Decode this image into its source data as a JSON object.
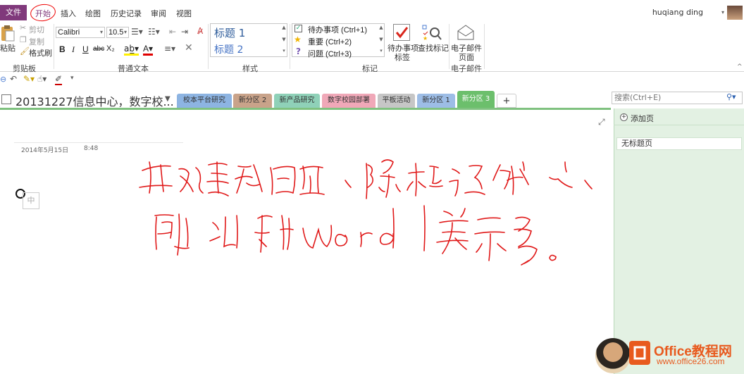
{
  "menubar": {
    "file_label": "文件",
    "tabs": [
      "开始",
      "插入",
      "绘图",
      "历史记录",
      "审阅",
      "视图"
    ],
    "active_tab": "开始",
    "user_name": "huqiang ding"
  },
  "clipboard": {
    "paste": "粘贴",
    "cut": "剪切",
    "copy": "复制",
    "format_painter": "格式刷",
    "group_label": "剪贴板"
  },
  "basic_text": {
    "font_name": "Calibri",
    "font_size": "10.5",
    "bold": "B",
    "italic": "I",
    "underline": "U",
    "strike": "abc",
    "subscript": "X₂",
    "group_label": "普通文本"
  },
  "styles": {
    "heading1": "标题 1",
    "heading2": "标题 2",
    "group_label": "样式"
  },
  "tags": {
    "items": [
      "待办事项 (Ctrl+1)",
      "重要 (Ctrl+2)",
      "问题 (Ctrl+3)"
    ],
    "todo_tag_line1": "待办事项",
    "todo_tag_line2": "标签",
    "find_tags": "查找标记",
    "group_label": "标记"
  },
  "email": {
    "label_line1": "电子邮件",
    "label_line2": "页面",
    "group_label": "电子邮件"
  },
  "notebook": {
    "title": "20131227信息中心，数字校...",
    "sections": [
      {
        "label": "校本平台研究",
        "color": "#8db4e2"
      },
      {
        "label": "新分区 2",
        "color": "#c9a38a"
      },
      {
        "label": "新产品研究",
        "color": "#8fd1b8"
      },
      {
        "label": "数字校园部署",
        "color": "#f0a8b8"
      },
      {
        "label": "平板活动",
        "color": "#c6c6c6"
      },
      {
        "label": "新分区 1",
        "color": "#9dbde6"
      },
      {
        "label": "新分区 3",
        "color": "#6cbf6c"
      }
    ],
    "add_section": "+",
    "search_placeholder": "搜索(Ctrl+E)"
  },
  "page": {
    "date": "2014年5月15日",
    "time": "8:48",
    "handwriting_line1": "开始菜单较全面，除标记外，",
    "handwriting_line2": "别的和word差不多。"
  },
  "pages_panel": {
    "add_page": "添加页",
    "pages": [
      "无标题页"
    ]
  },
  "watermark": {
    "brand": "Office教程网",
    "url": "www.office26.com"
  }
}
